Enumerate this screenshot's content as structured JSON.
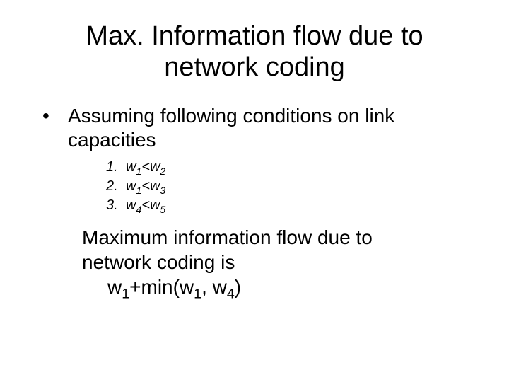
{
  "title_line1": "Max. Information flow due to",
  "title_line2": "network coding",
  "bullet": {
    "marker": "•",
    "text_line1": "Assuming following conditions on link",
    "text_line2": "capacities"
  },
  "conditions": {
    "item1": {
      "num": "1.",
      "a": "w",
      "ai": "1",
      "op": "<",
      "b": "w",
      "bi": "2"
    },
    "item2": {
      "num": "2.",
      "a": "w",
      "ai": "1",
      "op": "<",
      "b": "w",
      "bi": "3"
    },
    "item3": {
      "num": "3.",
      "a": "w",
      "ai": "4",
      "op": "<",
      "b": "w",
      "bi": "5"
    }
  },
  "conclusion": {
    "line1": "Maximum information flow due to",
    "line2": "network coding is",
    "expr_pre": "w",
    "expr_s1": "1",
    "expr_mid": "+min(w",
    "expr_s2": "1",
    "expr_comma": ",",
    "expr_mid2": " w",
    "expr_s3": "4",
    "expr_post": ")"
  }
}
